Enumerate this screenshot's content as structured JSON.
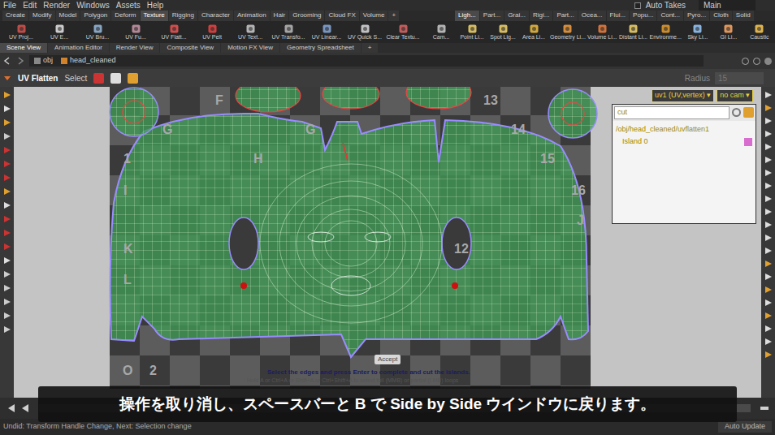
{
  "menu": [
    "File",
    "Edit",
    "Render",
    "Windows",
    "Assets",
    "Help"
  ],
  "takes": {
    "label": "Auto Takes",
    "checked": false
  },
  "desktop": "Main",
  "shelf_tabs": [
    {
      "label": "Create",
      "selected": false
    },
    {
      "label": "Modify",
      "selected": false
    },
    {
      "label": "Model",
      "selected": false
    },
    {
      "label": "Polygon",
      "selected": false
    },
    {
      "label": "Deform",
      "selected": false
    },
    {
      "label": "Texture",
      "selected": true
    },
    {
      "label": "Rigging",
      "selected": false
    },
    {
      "label": "Character",
      "selected": false
    },
    {
      "label": "Animation",
      "selected": false
    },
    {
      "label": "Hair",
      "selected": false
    },
    {
      "label": "Grooming",
      "selected": false
    },
    {
      "label": "Cloud FX",
      "selected": false
    },
    {
      "label": "Volume",
      "selected": false
    },
    {
      "label": "+",
      "selected": false
    }
  ],
  "shelf_tabs_right": [
    {
      "label": "Ligh...",
      "selected": true
    },
    {
      "label": "Part...",
      "selected": false
    },
    {
      "label": "Grai...",
      "selected": false
    },
    {
      "label": "Rigi...",
      "selected": false
    },
    {
      "label": "Part...",
      "selected": false
    },
    {
      "label": "Ocea...",
      "selected": false
    },
    {
      "label": "Flui...",
      "selected": false
    },
    {
      "label": "Popu...",
      "selected": false
    },
    {
      "label": "Cont...",
      "selected": false
    },
    {
      "label": "Pyro...",
      "selected": false
    },
    {
      "label": "Cloth",
      "selected": false
    },
    {
      "label": "Solid",
      "selected": false
    }
  ],
  "shelf_tools": [
    "UV Proj...",
    "UV E...",
    "UV Bru...",
    "UV Fu...",
    "UV Flatt...",
    "UV Pelt",
    "UV Text...",
    "UV Transfo...",
    "UV Linear...",
    "UV Quick S...",
    "Clear Textu..."
  ],
  "light_tools": [
    "Cam...",
    "Point Li...",
    "Spot Lig...",
    "Area Li...",
    "Geometry Li...",
    "Volume Li...",
    "Distant Li...",
    "Environme...",
    "Sky Li...",
    "GI Li...",
    "Caustic"
  ],
  "pane_tabs": [
    {
      "label": "Scene View",
      "selected": true
    },
    {
      "label": "Animation Editor",
      "selected": false
    },
    {
      "label": "Render View",
      "selected": false
    },
    {
      "label": "Composite View",
      "selected": false
    },
    {
      "label": "Motion FX View",
      "selected": false
    },
    {
      "label": "Geometry Spreadsheet",
      "selected": false
    },
    {
      "label": "+",
      "selected": false
    }
  ],
  "path": [
    "obj",
    "head_cleaned"
  ],
  "operation": {
    "title": "UV Flatten",
    "mode": "Select",
    "radius_label": "Radius",
    "radius": "15"
  },
  "viewport": {
    "uv_attrib": "uv1 (UV,vertex)",
    "camera": "no cam",
    "checker_labels": [
      "F",
      "13",
      "G",
      "G",
      "14",
      "1",
      "H",
      "15",
      "I",
      "16",
      "J",
      "K",
      "12",
      "L",
      "O",
      "2"
    ],
    "accept": "Accept",
    "hints": [
      "Select the edges and press Enter to complete and cut the islands.",
      "Hold A or Ctrl+A or Shift+A or Ctrl+Shift+A to select full (MMB) or partial (LMB) loops"
    ],
    "islands_panel": {
      "search": "cut",
      "node": "/obj/head_cleaned/uvflatten1",
      "islands": [
        {
          "label": "Island 0",
          "color": "#d96ccf"
        }
      ]
    }
  },
  "subtitle": "操作を取り消し、スペースバーと B で Side by Side ウインドウに戻ります。",
  "status": {
    "message": "Undid: Transform Handle Change, Next: Selection change",
    "auto_update": "Auto Update"
  }
}
